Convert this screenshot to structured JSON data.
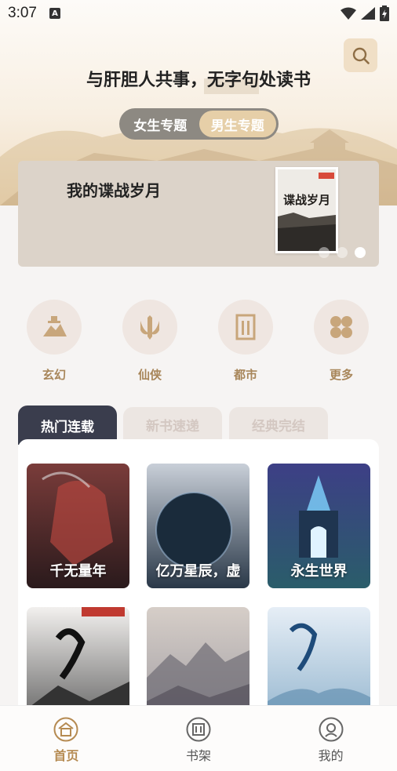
{
  "status_bar": {
    "time": "3:07",
    "notification_icon": "a-icon",
    "icons": [
      "wifi-icon",
      "signal-icon",
      "battery-icon"
    ]
  },
  "header": {
    "slogan": "与肝胆人共事，无字句处读书",
    "search_icon": "search-icon"
  },
  "gender_tabs": [
    {
      "label": "女生专题",
      "active": false
    },
    {
      "label": "男生专题",
      "active": true
    }
  ],
  "banner": {
    "title": "我的谍战岁月",
    "cover_text": "谍战岁月",
    "slide_count": 3,
    "active_slide": 3
  },
  "categories": [
    {
      "label": "玄幻",
      "icon": "mountain-icon"
    },
    {
      "label": "仙侠",
      "icon": "sword-icon"
    },
    {
      "label": "都市",
      "icon": "building-icon"
    },
    {
      "label": "更多",
      "icon": "grid-icon"
    }
  ],
  "rank_tabs": [
    {
      "label": "热门连载",
      "active": true
    },
    {
      "label": "新书速递",
      "active": false
    },
    {
      "label": "经典完结",
      "active": false
    }
  ],
  "books": [
    {
      "title": "千无量年",
      "color_top": "#7a3c3a",
      "color_bottom": "#2a1a1c"
    },
    {
      "title": "亿万星辰，虚",
      "color_top": "#c9cfd8",
      "color_bottom": "#2a3848"
    },
    {
      "title": "永生世界",
      "color_top": "#3d3f86",
      "color_bottom": "#2a5d6a"
    },
    {
      "title": "",
      "color_top": "#f2f0ee",
      "color_bottom": "#5a5a5a"
    },
    {
      "title": "",
      "color_top": "#d6cec8",
      "color_bottom": "#9d9aa0"
    },
    {
      "title": "",
      "color_top": "#e6eef6",
      "color_bottom": "#8fb2cc"
    }
  ],
  "bottom_nav": [
    {
      "label": "首页",
      "icon": "home-icon",
      "active": true
    },
    {
      "label": "书架",
      "icon": "bookshelf-icon",
      "active": false
    },
    {
      "label": "我的",
      "icon": "profile-icon",
      "active": false
    }
  ],
  "colors": {
    "accent": "#b58a51",
    "dark_tab": "#3a3d4d",
    "category_label": "#a8865a"
  }
}
